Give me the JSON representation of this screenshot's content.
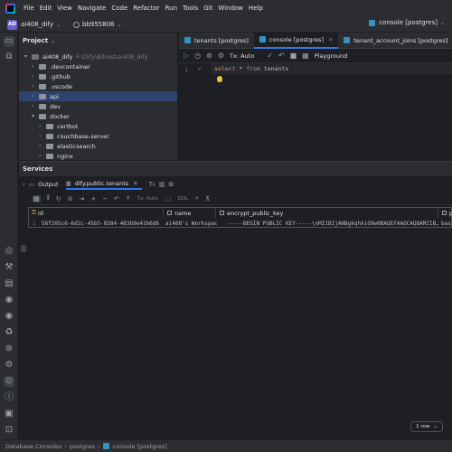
{
  "menu": [
    "File",
    "Edit",
    "View",
    "Navigate",
    "Code",
    "Refactor",
    "Run",
    "Tools",
    "Git",
    "Window",
    "Help"
  ],
  "project": {
    "badge": "AD",
    "name": "ai408_dify",
    "branch": "bb955806",
    "console_selector": "console [postgres]"
  },
  "project_panel": {
    "title": "Project",
    "tree": [
      {
        "label": "ai408_dify",
        "hint": "F:\\Dify\\Bifrost\\ai408_dify",
        "level": 0,
        "arrow": "▾",
        "root": true
      },
      {
        "label": ".devcontainer",
        "level": 1,
        "arrow": "›"
      },
      {
        "label": ".github",
        "level": 1,
        "arrow": "›"
      },
      {
        "label": ".vscode",
        "level": 1,
        "arrow": "›"
      },
      {
        "label": "api",
        "level": 1,
        "arrow": "›",
        "selected": true
      },
      {
        "label": "dev",
        "level": 1,
        "arrow": "›"
      },
      {
        "label": "docker",
        "level": 1,
        "arrow": "▾"
      },
      {
        "label": "certbot",
        "level": 2,
        "arrow": "›"
      },
      {
        "label": "couchbase-server",
        "level": 2,
        "arrow": "›"
      },
      {
        "label": "elasticsearch",
        "level": 2,
        "arrow": "›"
      },
      {
        "label": "nginx",
        "level": 2,
        "arrow": "›"
      }
    ]
  },
  "editor": {
    "tabs": [
      {
        "label": "tenants [postgres]",
        "active": false
      },
      {
        "label": "console [postgres]",
        "active": true
      },
      {
        "label": "tenant_account_joins [postgres]",
        "active": false
      }
    ],
    "tx_mode": "Tx: Auto",
    "playground": "Playground",
    "line_number": "1",
    "code_kw1": "select",
    "code_mid": " * ",
    "code_kw2": "from",
    "code_table": " tenants"
  },
  "services": {
    "title": "Services",
    "tabs": [
      {
        "label": "Output",
        "active": false
      },
      {
        "label": "dify.public.tenants",
        "active": true
      }
    ],
    "grid_tx": "Tx: Auto",
    "grid_ddl": "DDL",
    "columns": [
      {
        "label": "id",
        "key": true
      },
      {
        "label": "name",
        "key": false
      },
      {
        "label": "encrypt_public_key",
        "key": false
      },
      {
        "label": "p",
        "key": false
      }
    ],
    "rows": [
      {
        "num": "1",
        "id": "56f205c6-6d2c-45b5-8584-483b9e41b6d6",
        "name": "ai408's Workspace",
        "encrypt_public_key": "-----BEGIN PUBLIC KEY-----\\nMIIBIjANBgkqhkiG9w0BAQEFAAOCAQ8AMIIB…",
        "plan": "bas"
      }
    ],
    "row_count": "1 row"
  },
  "statusbar": {
    "crumbs": [
      "Database Consoles",
      "postgres",
      "console [postgres]"
    ]
  }
}
